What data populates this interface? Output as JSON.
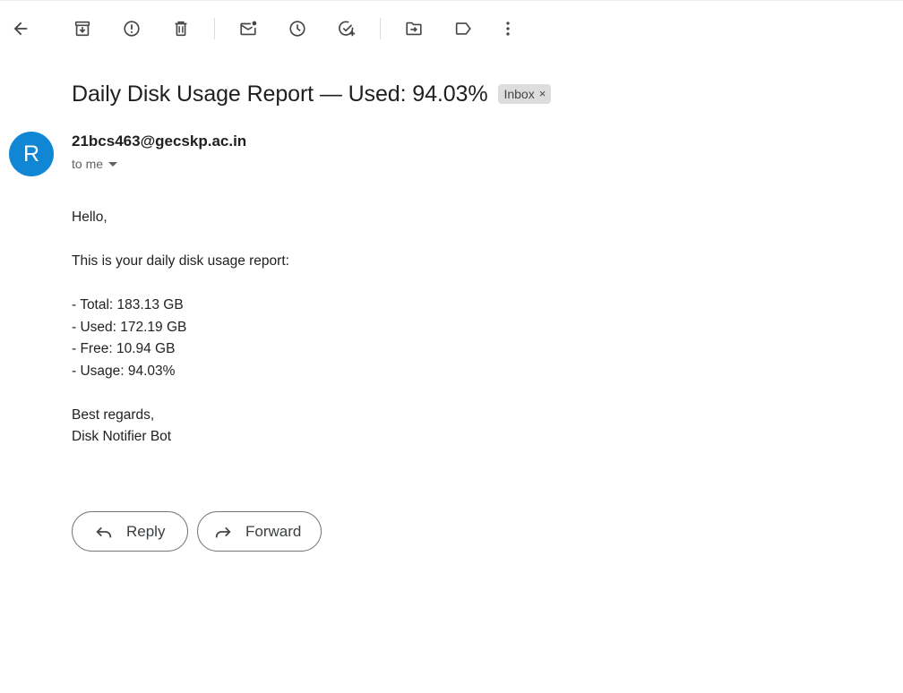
{
  "toolbar": {
    "icons": [
      "arrow-left-icon",
      "archive-icon",
      "report-spam-icon",
      "trash-icon",
      "mark-unread-icon",
      "snooze-icon",
      "add-task-icon",
      "move-to-icon",
      "label-icon",
      "more-vert-icon"
    ]
  },
  "email": {
    "subject": "Daily Disk Usage Report — Used: 94.03%",
    "label_chip": "Inbox",
    "label_remove": "×",
    "sender": {
      "avatar_letter": "R",
      "avatar_color": "#1186d4",
      "address": "21bcs463@gecskp.ac.in",
      "recipient": "to me"
    },
    "body": {
      "greeting": "Hello,",
      "intro": "This is your daily disk usage report:",
      "stats": [
        "- Total: 183.13 GB",
        "- Used: 172.19 GB",
        "- Free: 10.94 GB",
        "- Usage: 94.03%"
      ],
      "closing": "Best regards,",
      "signature": "Disk Notifier Bot"
    }
  },
  "actions": {
    "reply_label": "Reply",
    "forward_label": "Forward"
  }
}
